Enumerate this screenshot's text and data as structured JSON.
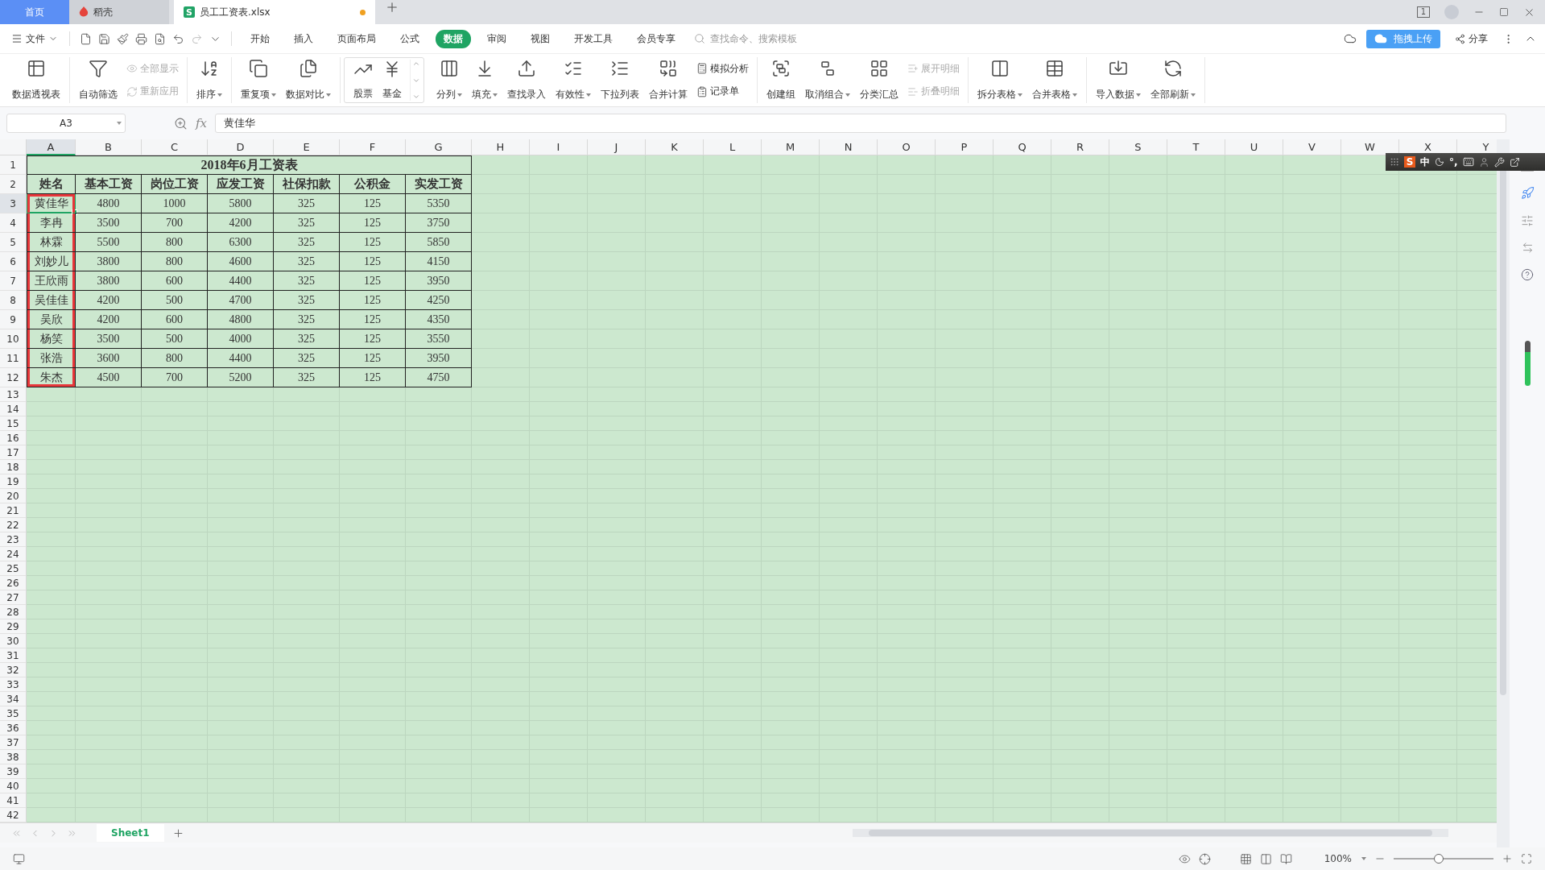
{
  "tabs": [
    {
      "kind": "home",
      "label": "首页",
      "selected": false
    },
    {
      "kind": "docer",
      "label": "稻壳",
      "selected": false
    },
    {
      "kind": "file",
      "label": "员工工资表.xlsx",
      "icon_letter": "S",
      "modified": true,
      "selected": true
    }
  ],
  "window_badge": "1",
  "menu": {
    "file_label": "文件",
    "tabs": [
      {
        "label": "开始",
        "selected": false
      },
      {
        "label": "插入",
        "selected": false
      },
      {
        "label": "页面布局",
        "selected": false
      },
      {
        "label": "公式",
        "selected": false
      },
      {
        "label": "数据",
        "selected": true
      },
      {
        "label": "审阅",
        "selected": false
      },
      {
        "label": "视图",
        "selected": false
      },
      {
        "label": "开发工具",
        "selected": false
      },
      {
        "label": "会员专享",
        "selected": false
      }
    ],
    "search_placeholder": "查找命令、搜索模板",
    "upload_badge": "拖拽上传",
    "share": "分享"
  },
  "ribbon": [
    {
      "framed": false,
      "items": [
        {
          "kind": "large",
          "label": "数据透视表",
          "dropdown": false,
          "disabled": false
        }
      ]
    },
    {
      "framed": false,
      "items": [
        {
          "kind": "large",
          "label": "自动筛选",
          "dropdown": false,
          "disabled": false
        },
        {
          "kind": "small",
          "label": "全部显示",
          "dropdown": false,
          "disabled": true
        },
        {
          "kind": "small",
          "label": "重新应用",
          "dropdown": false,
          "disabled": true
        }
      ]
    },
    {
      "framed": false,
      "items": [
        {
          "kind": "large",
          "label": "排序",
          "dropdown": true,
          "disabled": false
        }
      ]
    },
    {
      "framed": false,
      "items": [
        {
          "kind": "large",
          "label": "重复项",
          "dropdown": true,
          "disabled": false
        },
        {
          "kind": "large",
          "label": "数据对比",
          "dropdown": true,
          "disabled": false
        }
      ]
    },
    {
      "framed": true,
      "items": [
        {
          "kind": "large",
          "label": "股票",
          "dropdown": false,
          "disabled": false
        },
        {
          "kind": "large",
          "label": "基金",
          "dropdown": false,
          "disabled": false
        }
      ]
    },
    {
      "framed": false,
      "items": [
        {
          "kind": "large",
          "label": "分列",
          "dropdown": true,
          "disabled": false
        },
        {
          "kind": "large",
          "label": "填充",
          "dropdown": true,
          "disabled": false
        },
        {
          "kind": "large",
          "label": "查找录入",
          "dropdown": false,
          "disabled": false
        },
        {
          "kind": "large",
          "label": "有效性",
          "dropdown": true,
          "disabled": false
        },
        {
          "kind": "large",
          "label": "下拉列表",
          "dropdown": false,
          "disabled": false
        },
        {
          "kind": "large",
          "label": "合并计算",
          "dropdown": false,
          "disabled": false
        },
        {
          "kind": "small",
          "label": "模拟分析",
          "dropdown": false,
          "disabled": false
        },
        {
          "kind": "small",
          "label": "记录单",
          "dropdown": false,
          "disabled": false
        }
      ]
    },
    {
      "framed": false,
      "items": [
        {
          "kind": "large",
          "label": "创建组",
          "dropdown": false,
          "disabled": false
        },
        {
          "kind": "large",
          "label": "取消组合",
          "dropdown": true,
          "disabled": false
        },
        {
          "kind": "large",
          "label": "分类汇总",
          "dropdown": false,
          "disabled": false
        },
        {
          "kind": "small",
          "label": "展开明细",
          "dropdown": false,
          "disabled": true
        },
        {
          "kind": "small",
          "label": "折叠明细",
          "dropdown": false,
          "disabled": true
        }
      ]
    },
    {
      "framed": false,
      "items": [
        {
          "kind": "large",
          "label": "拆分表格",
          "dropdown": true,
          "disabled": false
        },
        {
          "kind": "large",
          "label": "合并表格",
          "dropdown": true,
          "disabled": false
        }
      ]
    },
    {
      "framed": false,
      "items": [
        {
          "kind": "large",
          "label": "导入数据",
          "dropdown": true,
          "disabled": false
        },
        {
          "kind": "large",
          "label": "全部刷新",
          "dropdown": true,
          "disabled": false
        }
      ]
    }
  ],
  "formula_bar": {
    "name_box": "A3",
    "fx": "fx",
    "content": "黄佳华"
  },
  "columns": [
    {
      "label": "A",
      "selected": true
    },
    {
      "label": "B",
      "selected": false
    },
    {
      "label": "C",
      "selected": false
    },
    {
      "label": "D",
      "selected": false
    },
    {
      "label": "E",
      "selected": false
    },
    {
      "label": "F",
      "selected": false
    },
    {
      "label": "G",
      "selected": false
    },
    {
      "label": "H",
      "selected": false
    },
    {
      "label": "I",
      "selected": false
    },
    {
      "label": "J",
      "selected": false
    },
    {
      "label": "K",
      "selected": false
    },
    {
      "label": "L",
      "selected": false
    },
    {
      "label": "M",
      "selected": false
    },
    {
      "label": "N",
      "selected": false
    },
    {
      "label": "O",
      "selected": false
    },
    {
      "label": "P",
      "selected": false
    },
    {
      "label": "Q",
      "selected": false
    },
    {
      "label": "R",
      "selected": false
    },
    {
      "label": "S",
      "selected": false
    },
    {
      "label": "T",
      "selected": false
    },
    {
      "label": "U",
      "selected": false
    },
    {
      "label": "V",
      "selected": false
    },
    {
      "label": "W",
      "selected": false
    },
    {
      "label": "X",
      "selected": false
    },
    {
      "label": "Y",
      "selected": false
    }
  ],
  "row_numbers": [
    {
      "label": "1",
      "selected": false
    },
    {
      "label": "2",
      "selected": false
    },
    {
      "label": "3",
      "selected": true
    },
    {
      "label": "4",
      "selected": false
    },
    {
      "label": "5",
      "selected": false
    },
    {
      "label": "6",
      "selected": false
    },
    {
      "label": "7",
      "selected": false
    },
    {
      "label": "8",
      "selected": false
    },
    {
      "label": "9",
      "selected": false
    },
    {
      "label": "10",
      "selected": false
    },
    {
      "label": "11",
      "selected": false
    },
    {
      "label": "12",
      "selected": false
    },
    {
      "label": "13",
      "selected": false
    },
    {
      "label": "14",
      "selected": false
    },
    {
      "label": "15",
      "selected": false
    },
    {
      "label": "16",
      "selected": false
    },
    {
      "label": "17",
      "selected": false
    },
    {
      "label": "18",
      "selected": false
    },
    {
      "label": "19",
      "selected": false
    },
    {
      "label": "20",
      "selected": false
    },
    {
      "label": "21",
      "selected": false
    },
    {
      "label": "22",
      "selected": false
    },
    {
      "label": "23",
      "selected": false
    },
    {
      "label": "24",
      "selected": false
    },
    {
      "label": "25",
      "selected": false
    },
    {
      "label": "26",
      "selected": false
    },
    {
      "label": "27",
      "selected": false
    },
    {
      "label": "28",
      "selected": false
    },
    {
      "label": "29",
      "selected": false
    },
    {
      "label": "30",
      "selected": false
    },
    {
      "label": "31",
      "selected": false
    },
    {
      "label": "32",
      "selected": false
    },
    {
      "label": "33",
      "selected": false
    },
    {
      "label": "34",
      "selected": false
    },
    {
      "label": "35",
      "selected": false
    },
    {
      "label": "36",
      "selected": false
    },
    {
      "label": "37",
      "selected": false
    },
    {
      "label": "38",
      "selected": false
    },
    {
      "label": "39",
      "selected": false
    },
    {
      "label": "40",
      "selected": false
    },
    {
      "label": "41",
      "selected": false
    },
    {
      "label": "42",
      "selected": false
    }
  ],
  "table": {
    "title": "2018年6月工资表",
    "headers": [
      "姓名",
      "基本工资",
      "岗位工资",
      "应发工资",
      "社保扣款",
      "公积金",
      "实发工资"
    ],
    "rows": [
      {
        "cells": [
          "黄佳华",
          "4800",
          "1000",
          "5800",
          "325",
          "125",
          "5350"
        ],
        "selected": true,
        "framed": true
      },
      {
        "cells": [
          "李冉",
          "3500",
          "700",
          "4200",
          "325",
          "125",
          "3750"
        ],
        "selected": false,
        "framed": true
      },
      {
        "cells": [
          "林霖",
          "5500",
          "800",
          "6300",
          "325",
          "125",
          "5850"
        ],
        "selected": false,
        "framed": true
      },
      {
        "cells": [
          "刘妙儿",
          "3800",
          "800",
          "4600",
          "325",
          "125",
          "4150"
        ],
        "selected": false,
        "framed": true
      },
      {
        "cells": [
          "王欣雨",
          "3800",
          "600",
          "4400",
          "325",
          "125",
          "3950"
        ],
        "selected": false,
        "framed": true
      },
      {
        "cells": [
          "吴佳佳",
          "4200",
          "500",
          "4700",
          "325",
          "125",
          "4250"
        ],
        "selected": false,
        "framed": true
      },
      {
        "cells": [
          "吴欣",
          "4200",
          "600",
          "4800",
          "325",
          "125",
          "4350"
        ],
        "selected": false,
        "framed": true
      },
      {
        "cells": [
          "杨笑",
          "3500",
          "500",
          "4000",
          "325",
          "125",
          "3550"
        ],
        "selected": false,
        "framed": true
      },
      {
        "cells": [
          "张浩",
          "3600",
          "800",
          "4400",
          "325",
          "125",
          "3950"
        ],
        "selected": false,
        "framed": true
      },
      {
        "cells": [
          "朱杰",
          "4500",
          "700",
          "5200",
          "325",
          "125",
          "4750"
        ],
        "selected": false,
        "framed": true
      }
    ]
  },
  "ime_bar": {
    "logo": "S",
    "mode": "中",
    "punct": "°,"
  },
  "sheets": [
    {
      "label": "Sheet1",
      "selected": true
    }
  ],
  "status": {
    "zoom": "100%",
    "zoom_slider": {
      "level": 0.45
    }
  }
}
